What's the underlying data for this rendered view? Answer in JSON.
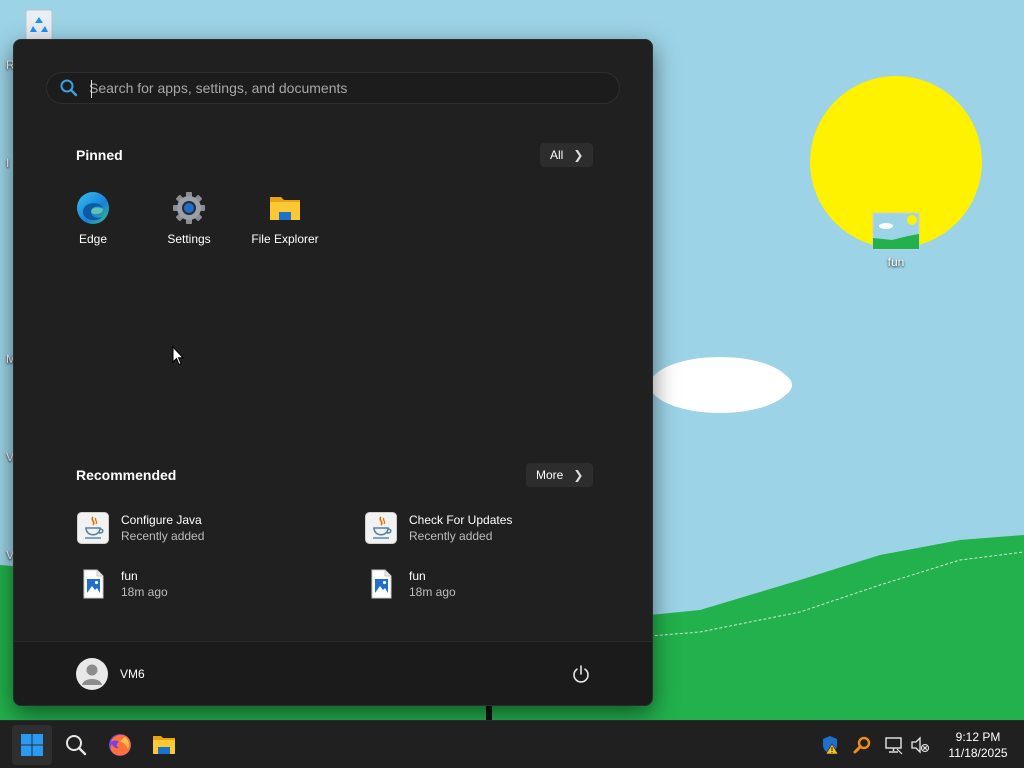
{
  "desktop": {
    "icons": [
      {
        "name": "Recycle Bin",
        "label": ""
      },
      {
        "name": "fun",
        "label": "fun"
      }
    ],
    "left_edge_letters": [
      "R",
      "I",
      "M",
      "V",
      "V"
    ]
  },
  "start_menu": {
    "search": {
      "placeholder": "Search for apps, settings, and documents",
      "value": ""
    },
    "pinned": {
      "title": "Pinned",
      "all_button": "All",
      "apps": [
        {
          "label": "Edge",
          "icon": "edge-icon"
        },
        {
          "label": "Settings",
          "icon": "gear-icon"
        },
        {
          "label": "File Explorer",
          "icon": "folder-icon"
        }
      ]
    },
    "recommended": {
      "title": "Recommended",
      "more_button": "More",
      "items": [
        {
          "name": "Configure Java",
          "sub": "Recently added",
          "icon": "java-icon"
        },
        {
          "name": "Check For Updates",
          "sub": "Recently added",
          "icon": "java-icon"
        },
        {
          "name": "fun",
          "sub": "18m ago",
          "icon": "image-file-icon"
        },
        {
          "name": "fun",
          "sub": "18m ago",
          "icon": "image-file-icon"
        }
      ]
    },
    "user": {
      "name": "VM6"
    }
  },
  "taskbar": {
    "apps": [
      "start-icon",
      "search-icon",
      "firefox-icon",
      "file-explorer-icon"
    ],
    "tray": [
      "security-warning-icon",
      "magnifier-tool-icon",
      "network-icon",
      "volume-muted-icon"
    ],
    "clock": {
      "time": "9:12 PM",
      "date": "11/18/2025"
    }
  },
  "colors": {
    "sky": "#9cd3e6",
    "sun": "#fff200",
    "grass": "#22b14c",
    "menu_bg": "#202020",
    "taskbar_bg": "#202020",
    "accent": "#0078d4"
  }
}
